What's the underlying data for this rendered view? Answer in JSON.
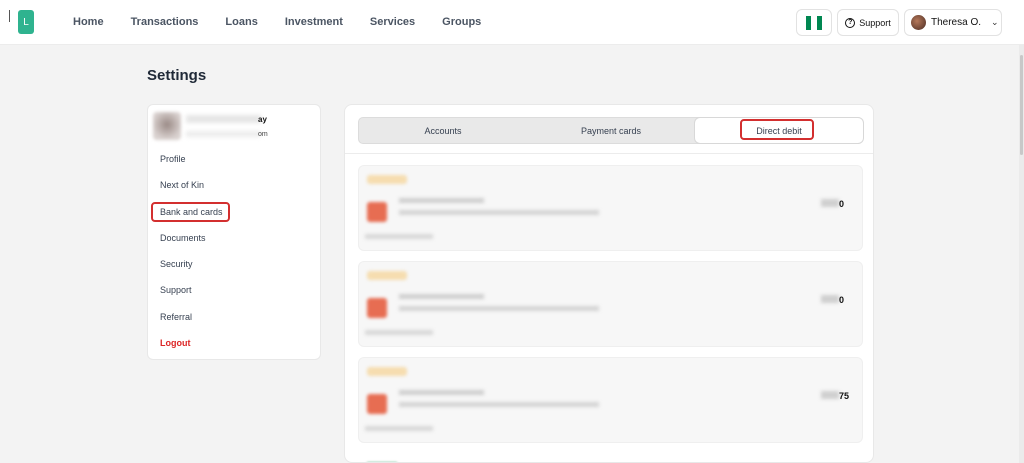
{
  "brand": {
    "logo_letter": "L"
  },
  "nav": {
    "items": [
      "Home",
      "Transactions",
      "Loans",
      "Investment",
      "Services",
      "Groups"
    ]
  },
  "header": {
    "support_label": "Support",
    "user_name": "Theresa O."
  },
  "page": {
    "title": "Settings"
  },
  "profile": {
    "name_visible_suffix": "ay",
    "email_visible_suffix": "om"
  },
  "sidebar": {
    "items": [
      {
        "label": "Profile"
      },
      {
        "label": "Next of Kin"
      },
      {
        "label": "Bank and cards"
      },
      {
        "label": "Documents"
      },
      {
        "label": "Security"
      },
      {
        "label": "Support"
      },
      {
        "label": "Referral"
      },
      {
        "label": "Logout"
      }
    ],
    "active": "Bank and cards"
  },
  "tabs": {
    "items": [
      "Accounts",
      "Payment cards",
      "Direct debit"
    ],
    "active": "Direct debit"
  },
  "debits": [
    {
      "amount_visible_suffix": "0"
    },
    {
      "amount_visible_suffix": "0"
    },
    {
      "amount_visible_suffix": "75"
    }
  ],
  "colors": {
    "brand": "#2fb38f",
    "highlight": "#d32f2f",
    "logout": "#dc2626",
    "flag_green": "#008751"
  }
}
